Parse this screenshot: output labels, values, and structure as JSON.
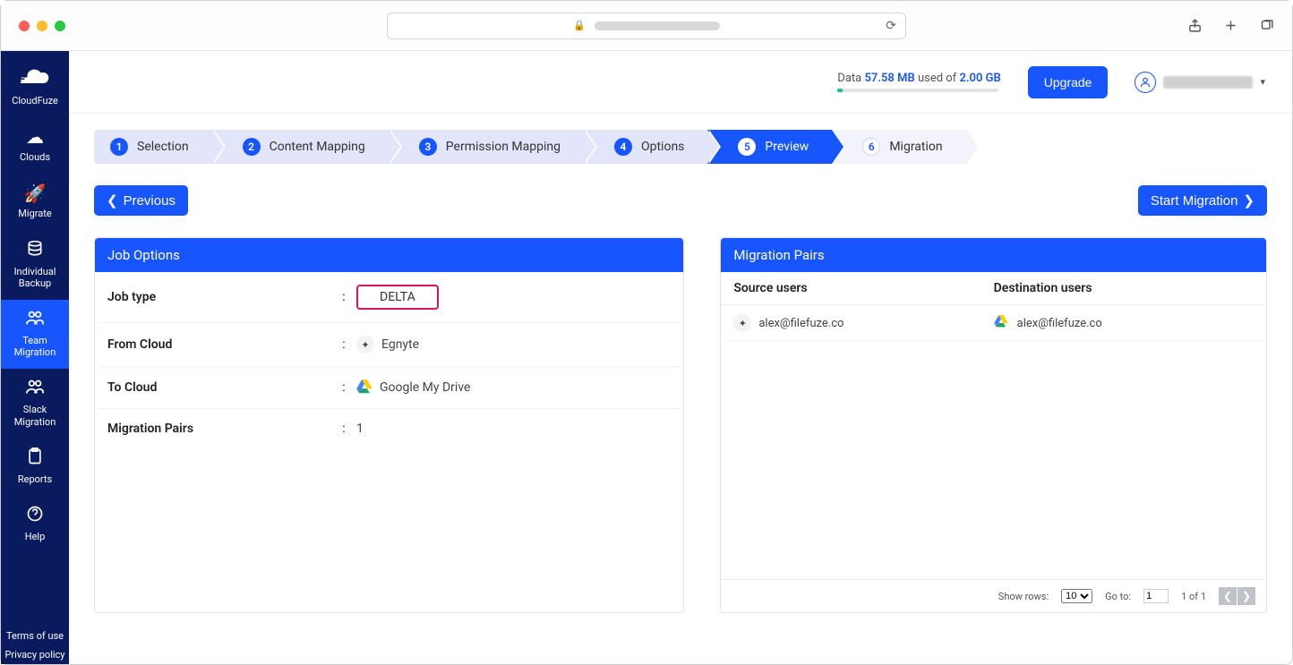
{
  "sidebar": {
    "brand": "CloudFuze",
    "items": [
      {
        "label": "Clouds"
      },
      {
        "label": "Migrate"
      },
      {
        "label": "Individual Backup"
      },
      {
        "label": "Team Migration"
      },
      {
        "label": "Slack Migration"
      },
      {
        "label": "Reports"
      },
      {
        "label": "Help"
      }
    ],
    "footer": {
      "terms": "Terms of use",
      "privacy": "Privacy policy"
    }
  },
  "topbar": {
    "usage_prefix": "Data ",
    "usage_used": "57.58 MB",
    "usage_mid": " used of ",
    "usage_total": "2.00 GB",
    "upgrade": "Upgrade"
  },
  "stepper": [
    {
      "num": "1",
      "label": "Selection"
    },
    {
      "num": "2",
      "label": "Content Mapping"
    },
    {
      "num": "3",
      "label": "Permission Mapping"
    },
    {
      "num": "4",
      "label": "Options"
    },
    {
      "num": "5",
      "label": "Preview"
    },
    {
      "num": "6",
      "label": "Migration"
    }
  ],
  "buttons": {
    "previous": "Previous",
    "start": "Start Migration"
  },
  "job_options": {
    "title": "Job Options",
    "rows": {
      "job_type": {
        "label": "Job type",
        "value": "DELTA"
      },
      "from_cloud": {
        "label": "From Cloud",
        "value": "Egnyte"
      },
      "to_cloud": {
        "label": "To Cloud",
        "value": "Google My Drive"
      },
      "pairs": {
        "label": "Migration Pairs",
        "value": "1"
      }
    }
  },
  "migration_pairs": {
    "title": "Migration Pairs",
    "headers": {
      "src": "Source users",
      "dst": "Destination users"
    },
    "rows": [
      {
        "src": "alex@filefuze.co",
        "dst": "alex@filefuze.co"
      }
    ],
    "footer": {
      "show_rows_label": "Show rows:",
      "show_rows_value": "10",
      "goto_label": "Go to:",
      "goto_value": "1",
      "page_of": "1 of 1"
    }
  }
}
